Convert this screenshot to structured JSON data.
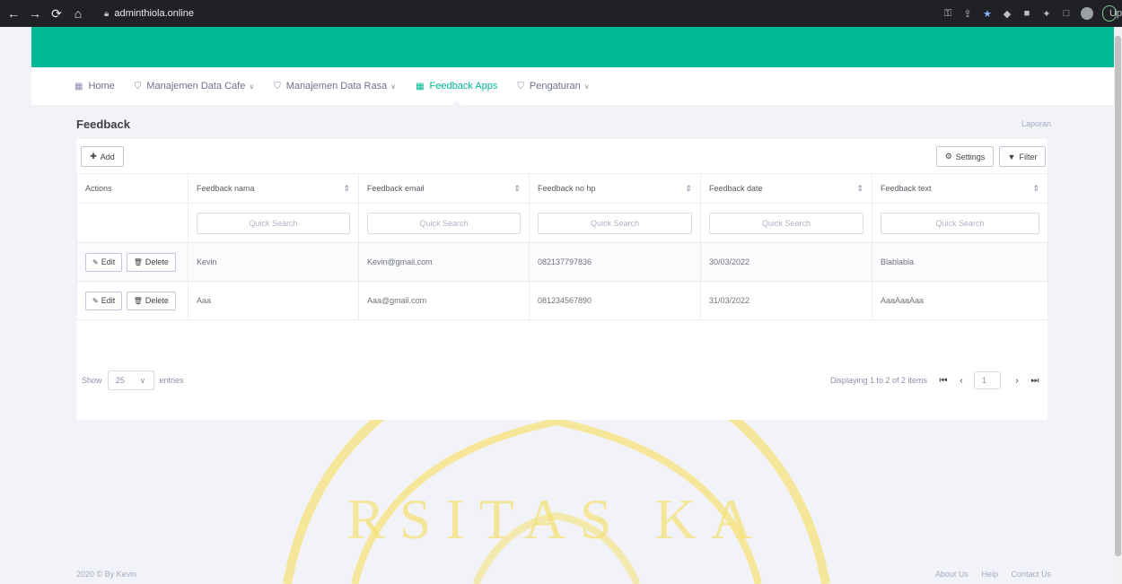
{
  "browser": {
    "url": "adminthiola.online",
    "update_label": "Update"
  },
  "menu": {
    "items": [
      {
        "label": "Home",
        "has_caret": false
      },
      {
        "label": "Manajemen Data Cafe",
        "has_caret": true
      },
      {
        "label": "Manajemen Data Rasa",
        "has_caret": true
      },
      {
        "label": "Feedback Apps",
        "has_caret": false,
        "active": true
      },
      {
        "label": "Pengaturan",
        "has_caret": true
      }
    ]
  },
  "page": {
    "title": "Feedback",
    "report_link": "Laporan"
  },
  "toolbar": {
    "add_label": "Add",
    "settings_label": "Settings",
    "filter_label": "Filter"
  },
  "table": {
    "columns": [
      "Actions",
      "Feedback nama",
      "Feedback email",
      "Feedback no hp",
      "Feedback date",
      "Feedback text"
    ],
    "quick_search_placeholder": "Quick Search",
    "edit_label": "Edit",
    "delete_label": "Delete",
    "rows": [
      {
        "nama": "Kevin",
        "email": "Kevin@gmail.com",
        "no_hp": "082137797836",
        "date": "30/03/2022",
        "text": "Blablabla"
      },
      {
        "nama": "Aaa",
        "email": "Aaa@gmail.com",
        "no_hp": "081234567890",
        "date": "31/03/2022",
        "text": "AaaAaaAaa"
      }
    ]
  },
  "pagination": {
    "show_label": "Show",
    "page_size": "25",
    "entries_label": "entries",
    "summary": "Displaying 1 to 2 of 2 items",
    "current_page": "1"
  },
  "footer": {
    "copyright": "2020 © By Kevin",
    "links": [
      "About Us",
      "Help",
      "Contact Us"
    ]
  },
  "watermark": {
    "text": "RSITAS KA"
  },
  "colors": {
    "brand_green": "#00b894",
    "background": "#f2f3f8",
    "watermark": "#f5e27a"
  }
}
